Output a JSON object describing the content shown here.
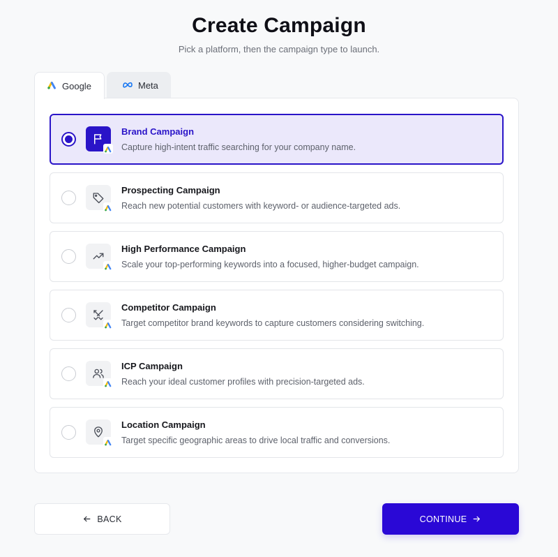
{
  "header": {
    "title": "Create Campaign",
    "subtitle": "Pick a platform, then the campaign type to launch."
  },
  "tabs": [
    {
      "label": "Google",
      "icon": "google-ads-icon",
      "active": true
    },
    {
      "label": "Meta",
      "icon": "meta-icon",
      "active": false
    }
  ],
  "options": [
    {
      "title": "Brand Campaign",
      "description": "Capture high-intent traffic searching for your company name.",
      "icon": "flag-icon",
      "selected": true
    },
    {
      "title": "Prospecting Campaign",
      "description": "Reach new potential customers with keyword- or audience-targeted ads.",
      "icon": "tag-icon",
      "selected": false
    },
    {
      "title": "High Performance Campaign",
      "description": "Scale your top-performing keywords into a focused, higher-budget campaign.",
      "icon": "trending-up-icon",
      "selected": false
    },
    {
      "title": "Competitor Campaign",
      "description": "Target competitor brand keywords to capture customers considering switching.",
      "icon": "crossed-swords-icon",
      "selected": false
    },
    {
      "title": "ICP Campaign",
      "description": "Reach your ideal customer profiles with precision-targeted ads.",
      "icon": "users-icon",
      "selected": false
    },
    {
      "title": "Location Campaign",
      "description": "Target specific geographic areas to drive local traffic and conversions.",
      "icon": "map-pin-icon",
      "selected": false
    }
  ],
  "footer": {
    "back_label": "BACK",
    "continue_label": "CONTINUE"
  },
  "colors": {
    "accent": "#2a08d6",
    "selected_bg": "#ebe8fb",
    "google_blue": "#4285f4",
    "google_yellow": "#fbbc04",
    "google_green": "#34a853"
  }
}
